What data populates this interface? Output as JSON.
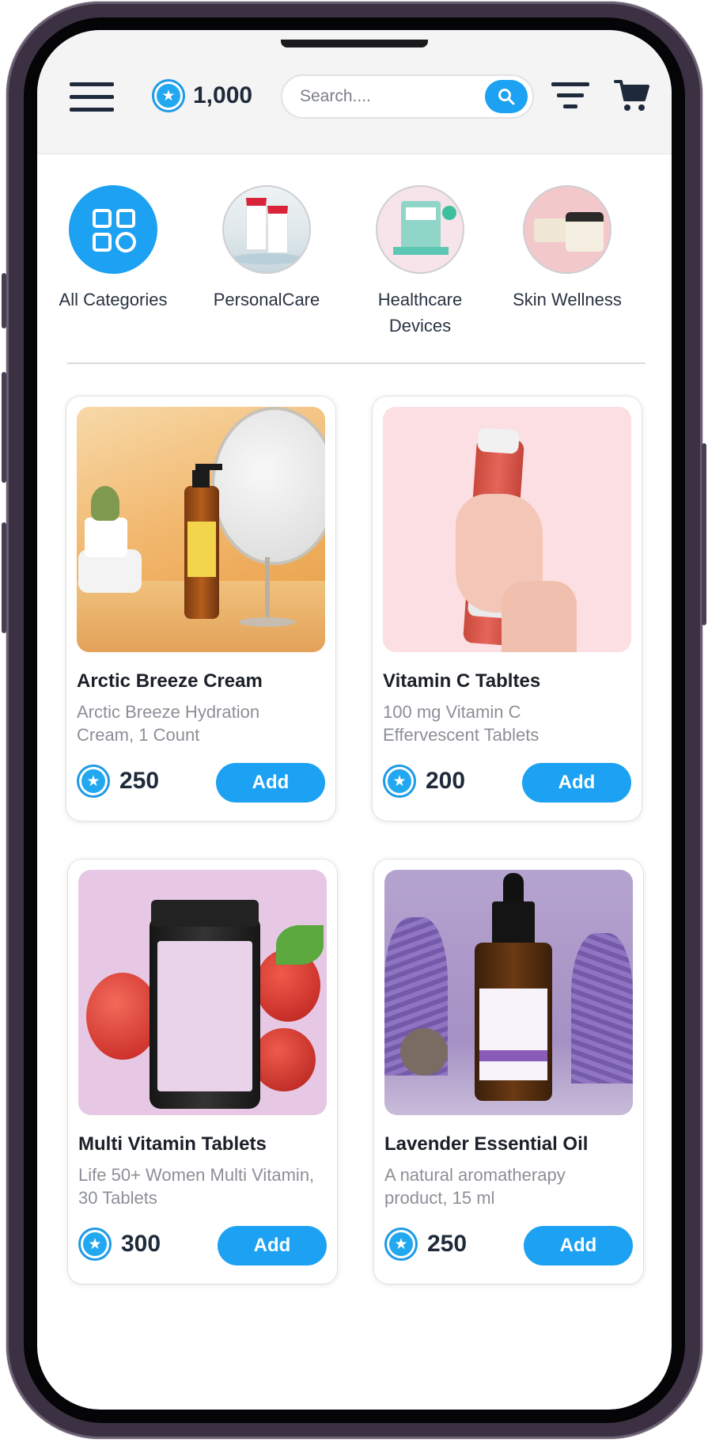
{
  "header": {
    "points": "1,000",
    "search_placeholder": "Search...."
  },
  "categories": [
    {
      "label": "All Categories"
    },
    {
      "label": "PersonalCare"
    },
    {
      "label": "Healthcare Devices"
    },
    {
      "label": "Skin Wellness"
    }
  ],
  "products": [
    {
      "title": "Arctic Breeze Cream",
      "description": "Arctic Breeze Hydration Cream, 1 Count",
      "price": "250",
      "add_label": "Add"
    },
    {
      "title": "Vitamin C Tabltes",
      "description": "100 mg Vitamin C Effervescent Tablets",
      "price": "200",
      "add_label": "Add"
    },
    {
      "title": "Multi Vitamin Tablets",
      "description": "Life 50+ Women Multi Vitamin, 30 Tablets",
      "price": "300",
      "add_label": "Add"
    },
    {
      "title": "Lavender Essential Oil",
      "description": "A natural aromatherapy product, 15 ml",
      "price": "250",
      "add_label": "Add"
    }
  ],
  "colors": {
    "accent": "#1da1f2",
    "text_dark": "#1f2a3a",
    "text_muted": "#8c8f96",
    "header_bg": "#f4f4f5"
  },
  "icons": [
    "menu-icon",
    "star-icon",
    "search-icon",
    "filter-icon",
    "cart-icon",
    "grid-icon"
  ]
}
